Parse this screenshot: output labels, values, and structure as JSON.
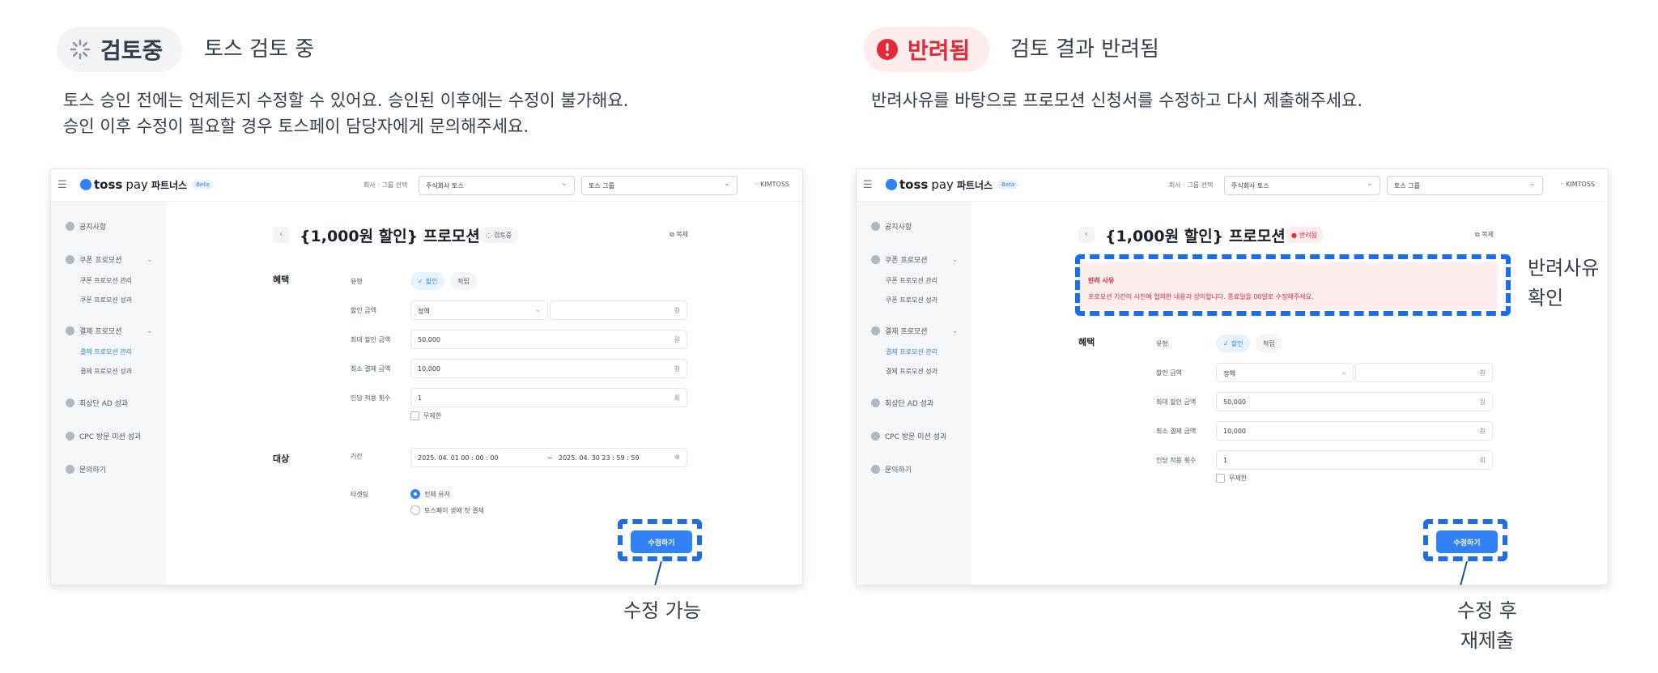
{
  "left": {
    "status_label": "검토중",
    "status_title": "토스 검토 중",
    "desc": [
      "토스 승인 전에는 언제든지 수정할 수 있어요. 승인된 이후에는 수정이 불가해요.",
      "승인 이후 수정이 필요할 경우 토스페이 담당자에게 문의해주세요."
    ],
    "badge": "검토중",
    "callout": "수정 가능"
  },
  "right": {
    "status_label": "반려됨",
    "status_title": "검토 결과 반려됨",
    "desc": [
      "반려사유를 바탕으로 프로모션 신청서를 수정하고 다시 제출해주세요."
    ],
    "badge": "반려됨",
    "alert_title": "반려 사유",
    "alert_body": "프로모션 기간이 사전에 협의한 내용과 상이합니다. 종료일을 00일로 수정해주세요.",
    "callout_side": [
      "반려사유",
      "확인"
    ],
    "callout": [
      "수정 후",
      "재제출"
    ]
  },
  "app": {
    "brand": "toss",
    "brand_pay": "pay",
    "brand_partners": "파트너스",
    "beta": "Beta",
    "group_select_label": "회사 · 그룹 선택",
    "company": "주식회사 토스",
    "group": "토스 그룹",
    "user": "KIMTOSS",
    "sidebar": {
      "notice": "공지사항",
      "coupon": "쿠폰 프로모션",
      "coupon_manage": "쿠폰 프로모션 관리",
      "coupon_result": "쿠폰 프로모션 성과",
      "payment": "결제 프로모션",
      "payment_manage": "결제 프로모션 관리",
      "payment_result": "결제 프로모션 성과",
      "top_ad": "최상단 AD 성과",
      "cpc": "CPC 방문 미션 성과",
      "inquiry": "문의하기"
    },
    "page_title": "{1,000원 할인} 프로모션",
    "copy": "복제",
    "benefit": "혜택",
    "target": "대상",
    "type_label": "유형",
    "discount_chip": "할인",
    "accrual_chip": "적립",
    "discount_amount_label": "할인 금액",
    "discount_mode": "정액",
    "won": "원",
    "max_discount_label": "최대 할인 금액",
    "max_discount": "50,000",
    "min_pay_label": "최소 결제 금액",
    "min_pay": "10,000",
    "per_user_label": "인당 적용 횟수",
    "per_user": "1",
    "times": "회",
    "unlimited": "무제한",
    "period_label": "기간",
    "period_start": "2025. 04. 01    00 : 00 : 00",
    "tilde": "~",
    "period_end": "2025. 04. 30    23 : 59 : 59",
    "targeting_label": "타겟팅",
    "all_users": "전체 유저",
    "first_pay": "토스페이 생애 첫 결제",
    "edit_button": "수정하기"
  }
}
